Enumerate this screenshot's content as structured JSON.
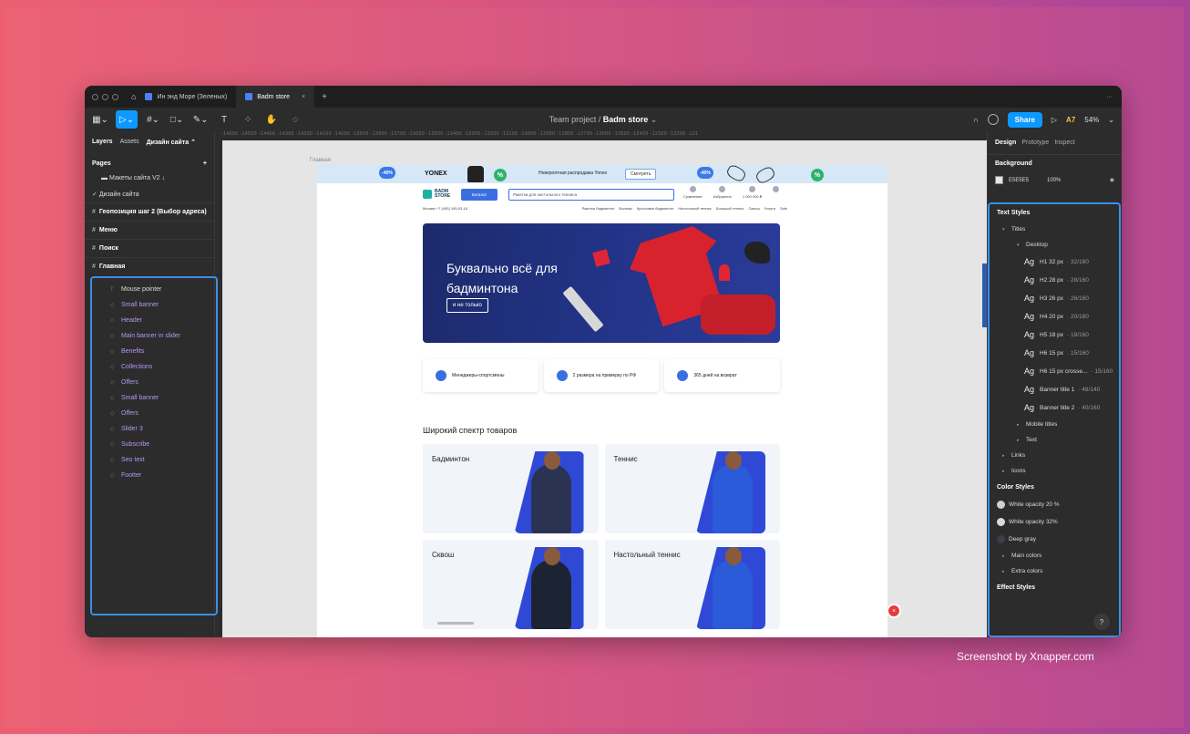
{
  "watermark": "Screenshot by Xnapper.com",
  "tabs": [
    {
      "label": "Ин энд Море (Зеленых)"
    },
    {
      "label": "Badm store"
    }
  ],
  "toolbar": {
    "project": "Team project",
    "separator": "/",
    "file": "Badm store",
    "share": "Share",
    "user_initials": "A7",
    "zoom": "54%"
  },
  "ruler_text": "-14600 -14500 -14400 -14300 -14200 -14100 -14000 -13900 -13800 -13700 -13600 -13500 -13400 -13300 -13200 -13100 -13000 -12900 -12800 -12700 -12600 -12500 -12400 -12300 -12200 -121",
  "left_panel": {
    "tab_layers": "Layers",
    "tab_assets": "Assets",
    "current_page": "Дизайн сайта",
    "pages_title": "Pages",
    "pages": [
      "Макеты сайта V2 ↓",
      "Дизайн сайта"
    ],
    "frames": [
      "Геопозиция шаг 2 (Выбор адреса)",
      "Меню",
      "Поиск",
      "Главная"
    ],
    "layers": [
      "Mouse pointer",
      "Small banner",
      "Header",
      "Main banner in slider",
      "Benefits",
      "Collections",
      "Offers",
      "Small banner",
      "Offers",
      "Slider 3",
      "Subscribe",
      "Seo text",
      "Footter"
    ]
  },
  "canvas": {
    "frame_label": "Главная",
    "promo": {
      "badge1": "-40%",
      "brand": "YONEX",
      "badge_green": "%",
      "text": "Невероятная распродажа Yonex",
      "button": "Смотреть",
      "badge2": "-40%",
      "badge_green2": "%"
    },
    "header": {
      "logo_line1": "BADM",
      "logo_line2": "STORE",
      "catalog": "Каталог",
      "search_placeholder": "Ракетки для настольного тенниса",
      "icons": [
        "Сравнение",
        "Избранное",
        "1 000 000 ₽",
        ""
      ],
      "location": "Москва +7 (495) 165-53-16",
      "nav": [
        "Ракетки бадминтон",
        "Воланы",
        "Кроссовки бадминтон",
        "Настольный теннис",
        "Большой теннис",
        "Сквош",
        "Услуги",
        "Sale"
      ]
    },
    "hero": {
      "title": "Буквально всё для бадминтона",
      "button": "и не только"
    },
    "benefits": [
      "Менеджеры-спортсмены",
      "2 размера на примерку по РФ",
      "365 дней на возврат"
    ],
    "section_title": "Широкий спектр товаров",
    "categories": [
      "Бадминтон",
      "Теннис",
      "Сквош",
      "Настольный теннис"
    ],
    "float_button": "×"
  },
  "right_panel": {
    "tabs": [
      "Design",
      "Prototype",
      "Inspect"
    ],
    "background_label": "Background",
    "background_hex": "E5E5E5",
    "background_opacity": "100%",
    "text_styles": "Text Styles",
    "titles": "Titles",
    "desktop": "Desktop",
    "styles": [
      {
        "ag": "Ag",
        "name": "H1 32 px",
        "meta": "· 32/160"
      },
      {
        "ag": "Ag",
        "name": "H2 28 px",
        "meta": "· 28/160"
      },
      {
        "ag": "Ag",
        "name": "H3 26 px",
        "meta": "· 26/160"
      },
      {
        "ag": "Ag",
        "name": "H4 20 px",
        "meta": "· 20/160"
      },
      {
        "ag": "Ag",
        "name": "H5 18 px",
        "meta": "· 18/160"
      },
      {
        "ag": "Ag",
        "name": "H6 15 px",
        "meta": "· 15/160"
      },
      {
        "ag": "Ag",
        "name": "H6 15 px crosse...",
        "meta": "· 15/160"
      },
      {
        "ag": "Ag",
        "name": "Banner title 1",
        "meta": "· 48/140"
      },
      {
        "ag": "Ag",
        "name": "Banner title 2",
        "meta": "· 40/160"
      }
    ],
    "mobile_titles": "Mobile titles",
    "text": "Text",
    "links": "Links",
    "icons": "Icons",
    "color_styles": "Color Styles",
    "colors": [
      {
        "name": "White opacity 20 %",
        "color": "#cfcfcf"
      },
      {
        "name": "White opacity 32%",
        "color": "#d9d9d9"
      },
      {
        "name": "Deep gray",
        "color": "#3c3f4a"
      }
    ],
    "main_colors": "Main colors",
    "extra_colors": "Extra colors",
    "effect_styles": "Effect Styles",
    "help": "?"
  }
}
